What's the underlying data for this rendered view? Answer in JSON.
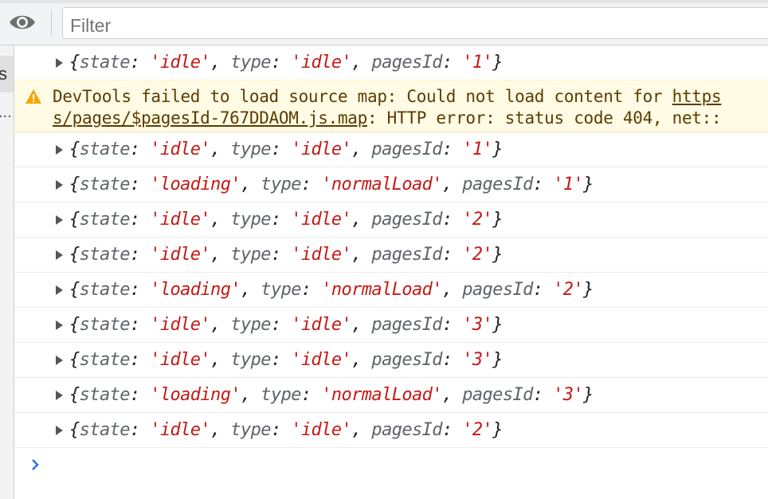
{
  "toolbar": {
    "eye_icon": "eye-icon",
    "filter_placeholder": "Filter",
    "filter_value": ""
  },
  "sidebar": {
    "selected_fragment": "s",
    "truncated_fragment": "..."
  },
  "logs": [
    {
      "state": "idle",
      "type": "idle",
      "pagesId": "1"
    },
    {
      "state": "idle",
      "type": "idle",
      "pagesId": "1"
    },
    {
      "state": "loading",
      "type": "normalLoad",
      "pagesId": "1"
    },
    {
      "state": "idle",
      "type": "idle",
      "pagesId": "2"
    },
    {
      "state": "idle",
      "type": "idle",
      "pagesId": "2"
    },
    {
      "state": "loading",
      "type": "normalLoad",
      "pagesId": "2"
    },
    {
      "state": "idle",
      "type": "idle",
      "pagesId": "3"
    },
    {
      "state": "idle",
      "type": "idle",
      "pagesId": "3"
    },
    {
      "state": "loading",
      "type": "normalLoad",
      "pagesId": "3"
    },
    {
      "state": "idle",
      "type": "idle",
      "pagesId": "2"
    }
  ],
  "warning": {
    "icon": "warning-icon",
    "line1_text": "DevTools failed to load source map: Could not load content for ",
    "line1_link": "https",
    "line2_link": "s/pages/$pagesId-767DDAOM.js.map",
    "line2_text": ": HTTP error: status code 404, net::"
  },
  "prompt_icon": "chevron-right-icon",
  "colors": {
    "string": "#c41a16",
    "key": "#5f6368",
    "warning_bg": "#fffbe5",
    "warning_text": "#5c3c00",
    "prompt": "#1a73e8"
  }
}
